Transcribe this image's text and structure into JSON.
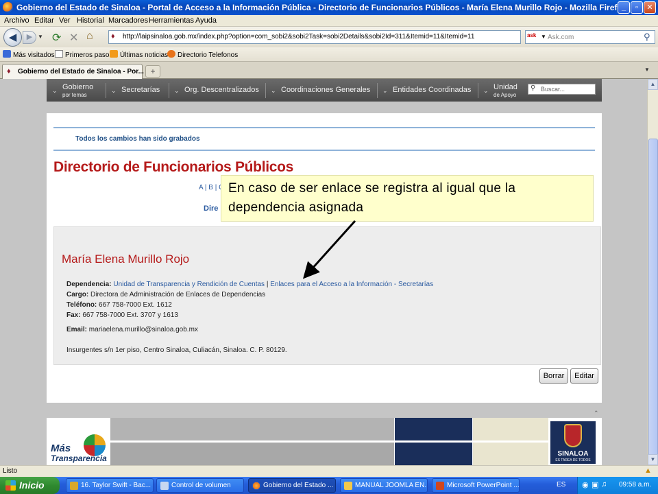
{
  "window": {
    "title": "Gobierno del Estado de Sinaloa - Portal de Acceso a la Información Pública - Directorio de Funcionarios Públicos - María Elena Murillo Rojo - Mozilla Firefox",
    "minimize": "_",
    "maximize": "▫",
    "close": "✕"
  },
  "menu": [
    "Archivo",
    "Editar",
    "Ver",
    "Historial",
    "Marcadores",
    "Herramientas",
    "Ayuda"
  ],
  "nav": {
    "url": "http://laipsinaloa.gob.mx/index.php?option=com_sobi2&sobi2Task=sobi2Details&sobi2Id=311&Itemid=11&Itemid=11",
    "search_placeholder": "Ask.com",
    "search_engine_label": "ask"
  },
  "bookmarks": [
    "Más visitados",
    "Primeros pasos",
    "Últimas noticias",
    "Directorio Telefonos"
  ],
  "tab": {
    "title": "Gobierno del Estado de Sinaloa - Por..."
  },
  "site_nav": {
    "items": [
      {
        "line1": "Gobierno",
        "line2": "por temas"
      },
      {
        "line1": "Secretarías"
      },
      {
        "line1": "Org. Descentralizados"
      },
      {
        "line1": "Coordinaciones Generales"
      },
      {
        "line1": "Entidades Coordinadas"
      },
      {
        "line1": "Unidad",
        "line2": "de Apoyo"
      }
    ],
    "search_placeholder": "Buscar..."
  },
  "content": {
    "saved_message": "Todos los cambios han sido grabados",
    "title": "Directorio de Funcionarios Públicos",
    "alpha": "A | B | C",
    "dir_link": "Dire"
  },
  "person": {
    "name": "María Elena Murillo Rojo",
    "dependencia_label": "Dependencia:",
    "dependencia_1": "Unidad de Transparencia y Rendición de Cuentas",
    "dependencia_sep": " | ",
    "dependencia_2": "Enlaces para el Acceso a la Información - Secretarías",
    "cargo_label": "Cargo:",
    "cargo": "Directora de Administración de Enlaces de Dependencias",
    "telefono_label": "Teléfono:",
    "telefono": "667 758-7000 Ext. 1612",
    "fax_label": "Fax:",
    "fax": "667 758-7000 Ext. 3707 y 1613",
    "email_label": "Email:",
    "email": "mariaelena.murillo@sinaloa.gob.mx",
    "address": "Insurgentes s/n 1er piso, Centro Sinaloa, Culiacán, Sinaloa. C. P. 80129."
  },
  "buttons": {
    "borrar": "Borrar",
    "editar": "Editar"
  },
  "callout": "En caso de ser enlace se registra al igual que la dependencia asignada",
  "footer": {
    "mas": "Más",
    "transparencia": "Transparencia",
    "sinaloa": "SINALOA",
    "sinaloa_tag": "ES TAREA DE TODOS"
  },
  "status": {
    "text": "Listo"
  },
  "taskbar": {
    "start": "Inicio",
    "tasks": [
      "16. Taylor Swift - Bac...",
      "Control de volumen",
      "Gobierno del Estado ...",
      "MANUAL JOOMLA EN...",
      "Microsoft PowerPoint ..."
    ],
    "lang": "ES",
    "clock": "09:58 a.m."
  },
  "colors": {
    "title_red": "#b51a1a",
    "link_blue": "#2a5aa0",
    "callout_bg": "#ffffcc",
    "xp_blue": "#245edb"
  }
}
